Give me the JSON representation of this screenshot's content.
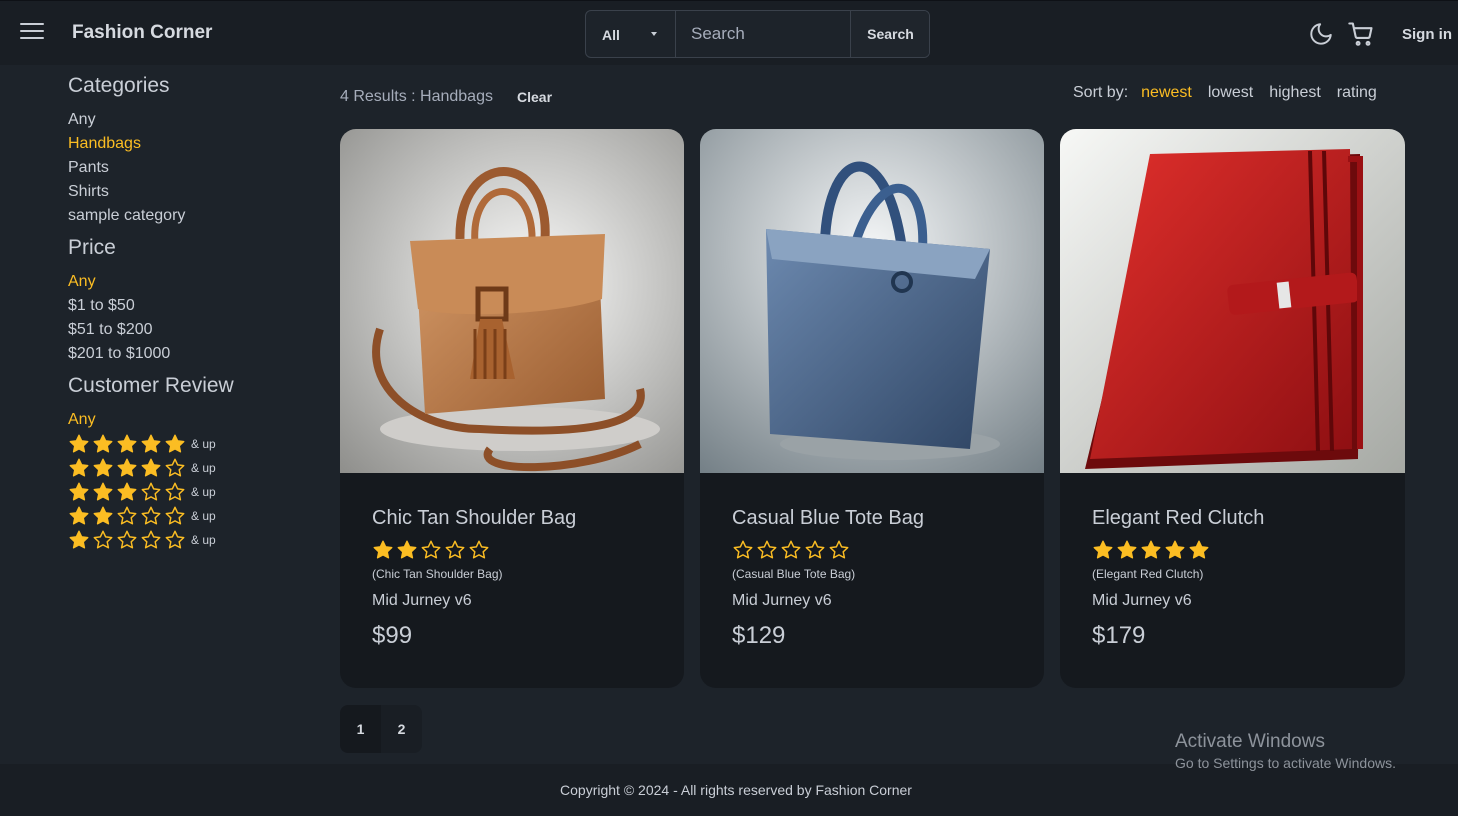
{
  "colors": {
    "accent": "#fbbd23",
    "background": "#1d232a",
    "navbar": "#191e24",
    "card": "#15191e"
  },
  "navbar": {
    "menu_icon": "hamburger-icon",
    "brand": "Fashion Corner",
    "search": {
      "category": "All",
      "placeholder": "Search",
      "button": "Search"
    },
    "theme_icon": "moon-icon",
    "cart_icon": "cart-icon",
    "sign_in": "Sign in"
  },
  "sidebar": {
    "categories": {
      "heading": "Categories",
      "items": [
        "Any",
        "Handbags",
        "Pants",
        "Shirts",
        "sample category"
      ],
      "active": "Handbags"
    },
    "price": {
      "heading": "Price",
      "items": [
        "Any",
        "$1 to $50",
        "$51 to $200",
        "$201 to $1000"
      ],
      "active": "Any"
    },
    "review": {
      "heading": "Customer Review",
      "any_label": "Any",
      "and_up": "& up",
      "ratings": [
        5,
        4,
        3,
        2,
        1
      ]
    }
  },
  "results": {
    "text": "4 Results : Handbags",
    "clear": "Clear"
  },
  "sort": {
    "label": "Sort by:",
    "options": [
      "newest",
      "lowest",
      "highest",
      "rating"
    ],
    "active": "newest"
  },
  "products": [
    {
      "name": "Chic Tan Shoulder Bag",
      "rating": 2,
      "subtitle": "(Chic Tan Shoulder Bag)",
      "brand": "Mid Jurney v6",
      "price": "$99",
      "image": "tan-shoulder-bag"
    },
    {
      "name": "Casual Blue Tote Bag",
      "rating": 0,
      "subtitle": "(Casual Blue Tote Bag)",
      "brand": "Mid Jurney v6",
      "price": "$129",
      "image": "blue-tote-bag"
    },
    {
      "name": "Elegant Red Clutch",
      "rating": 5,
      "subtitle": "(Elegant Red Clutch)",
      "brand": "Mid Jurney v6",
      "price": "$179",
      "image": "red-clutch"
    }
  ],
  "pagination": {
    "pages": [
      "1",
      "2"
    ],
    "current": "1"
  },
  "footer": {
    "text": "Copyright © 2024 - All rights reserved by Fashion Corner"
  },
  "watermark": {
    "line1": "Activate Windows",
    "line2": "Go to Settings to activate Windows."
  }
}
